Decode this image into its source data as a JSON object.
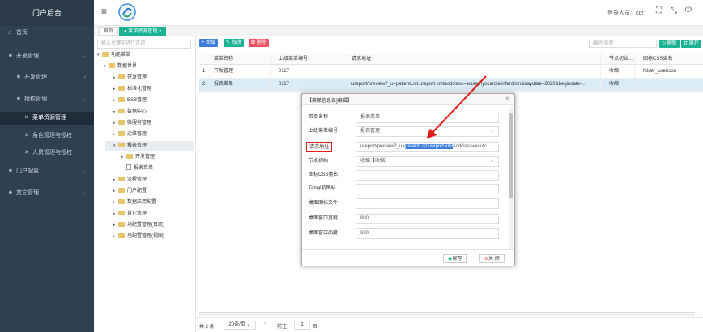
{
  "sidebar": {
    "title": "门户后台",
    "items": [
      {
        "label": "首页",
        "icon": "home-icon",
        "chevron": false
      },
      {
        "label": "开发管理",
        "icon": "gear-icon",
        "chevron": true
      },
      {
        "label": "开发管理",
        "icon": "gear-icon",
        "chevron": true
      },
      {
        "label": "授权管理",
        "icon": "gear-icon",
        "chevron": true
      },
      {
        "label": "菜单资源管理",
        "icon": "wrench-icon",
        "chevron": false
      },
      {
        "label": "角色管理与授权",
        "icon": "wrench-icon",
        "chevron": false
      },
      {
        "label": "人员管理与授权",
        "icon": "wrench-icon",
        "chevron": false
      },
      {
        "label": "门户配置",
        "icon": "gear-icon",
        "chevron": true
      },
      {
        "label": "其它管理",
        "icon": "gear-icon",
        "chevron": true
      }
    ]
  },
  "topbar": {
    "menu_icon": "≡",
    "user_label": "登录人员：cdr"
  },
  "tabs": {
    "home": "首页",
    "active": "菜单资源管理"
  },
  "tree": {
    "search_placeholder": "输入关键字进行过滤",
    "nodes": [
      "功能菜单",
      "数据世界",
      "开发管理",
      "标准化管理",
      "ESB管理",
      "数据中心",
      "微服务管理",
      "运维管理",
      "报表管理",
      "开发管理",
      "报表菜单",
      "流程管理",
      "门户配置",
      "数据应用配置",
      "其它管理",
      "场配置管理(日志)",
      "场配置管理(视图)"
    ]
  },
  "toolbar": {
    "add": "新增",
    "edit": "修改",
    "delete": "删除",
    "search_placeholder": "编码/名称",
    "refresh": "刷新",
    "expand": "展开"
  },
  "table": {
    "headers": [
      "菜单名称",
      "上级菜单编号",
      "请求地址",
      "节点初始...",
      "图标CSS类名"
    ],
    "rows": [
      {
        "num": "1",
        "name": "开发管理",
        "parent": "0117",
        "url": "",
        "node": "收缩",
        "icon": "folder_usericon"
      },
      {
        "num": "2",
        "name": "报表菜单",
        "parent": "0117",
        "url": "ureport/preview?_u=patientList.ureport.xml&cdclass=acutemyocardialinfarction&daydate=2020&begindate=...",
        "node": "收缩",
        "icon": ""
      }
    ]
  },
  "modal": {
    "title": "【菜单信息表]编辑】",
    "fields": [
      {
        "label": "菜单名称",
        "value": ""
      },
      {
        "label": "上级菜单编号",
        "value": "报表管理"
      },
      {
        "label": "请求地址",
        "value": ""
      },
      {
        "label": "节点初始",
        "value": "收缩【收缩】"
      },
      {
        "label": "图标CSS类名",
        "value": ""
      },
      {
        "label": "Tab导航图标",
        "value": ""
      },
      {
        "label": "桌面图标文件",
        "value": ""
      },
      {
        "label": "桌面窗口宽度",
        "value": "800"
      },
      {
        "label": "桌面窗口高度",
        "value": "600"
      }
    ],
    "name_value": "报表菜单",
    "url_pre": "ureport/preview?_u=",
    "url_sel": "patientList.ureport.xml",
    "url_post": "&cdclass=acutc",
    "save": "保存",
    "close": "关 闭"
  },
  "footer": {
    "total": "共 2 条",
    "page_size": "20条/页",
    "prev": "前往",
    "page": "1",
    "suffix": "页"
  },
  "colors": {
    "sidebar": "#2f4050",
    "accent": "#1ab394",
    "primary": "#3b7ddd",
    "danger": "#ed5565",
    "annotation": "#e31b1b"
  }
}
